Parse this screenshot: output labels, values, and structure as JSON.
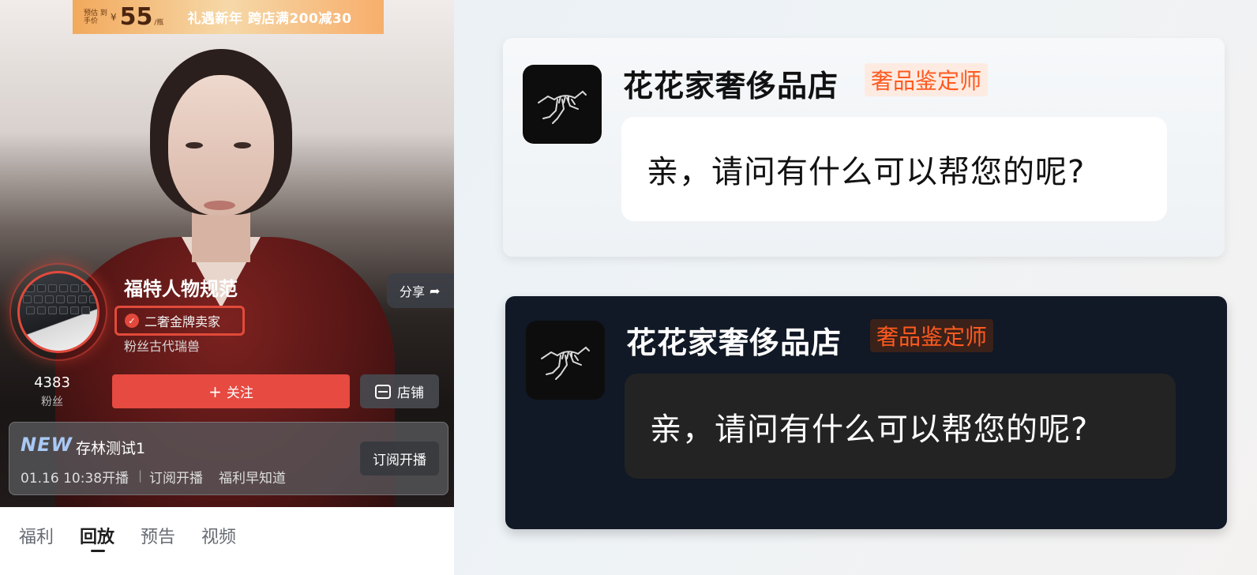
{
  "live_room": {
    "promo": {
      "small_text": "预估 到手价",
      "currency": "¥",
      "price": "55",
      "unit": "/瓶",
      "campaign": "礼遇新年 跨店满200减30"
    },
    "shop_name": "福特人物规范",
    "seller_badge": "二奢金牌卖家",
    "fan_name": "粉丝古代瑞兽",
    "share_label": "分享",
    "fans_count": "4383",
    "fans_label": "粉丝",
    "follow_label": "关注",
    "store_label": "店铺",
    "live_card": {
      "new_tag": "NEW",
      "title": "存林测试1",
      "time": "01.16 10:38开播",
      "subscribe_note": "订阅开播",
      "perk": "福利早知道",
      "subscribe_button": "订阅开播"
    },
    "tabs": [
      {
        "label": "福利",
        "active": false
      },
      {
        "label": "回放",
        "active": true
      },
      {
        "label": "预告",
        "active": false
      },
      {
        "label": "视频",
        "active": false
      }
    ]
  },
  "chat_cards": [
    {
      "theme": "light",
      "shop_name": "花花家奢侈品店",
      "role_tag": "奢品鉴定师",
      "message": "亲，请问有什么可以帮您的呢?",
      "logo_icon": "arcteryx-bird-logo-icon"
    },
    {
      "theme": "dark",
      "shop_name": "花花家奢侈品店",
      "role_tag": "奢品鉴定师",
      "message": "亲，请问有什么可以帮您的呢?",
      "logo_icon": "arcteryx-bird-logo-icon"
    }
  ],
  "colors": {
    "accent_red": "#e64a40",
    "role_tag_orange": "#ff5a1f",
    "dark_card_bg": "#111826"
  }
}
